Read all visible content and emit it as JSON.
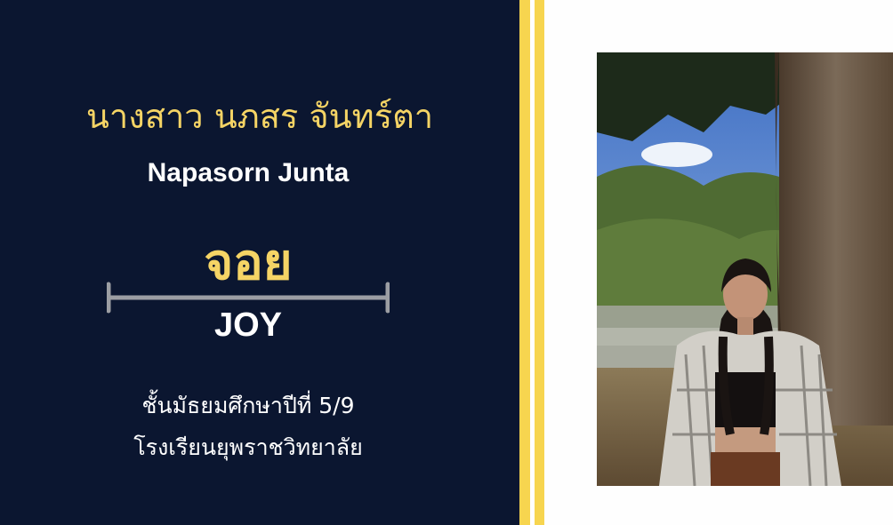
{
  "profile": {
    "name_thai": "นางสาว นภสร จันทร์ตา",
    "name_en": "Napasorn Junta",
    "nickname_thai": "จอย",
    "nickname_en": "JOY",
    "grade": "ชั้นมัธยมศึกษาปีที่ 5/9",
    "school": "โรงเรียนยุพราชวิทยาลัย"
  },
  "colors": {
    "panel_background": "#0b1630",
    "accent_yellow": "#f7d54f",
    "name_text": "#f5d465",
    "body_text": "#ffffff",
    "divider": "#9c9ea3"
  }
}
